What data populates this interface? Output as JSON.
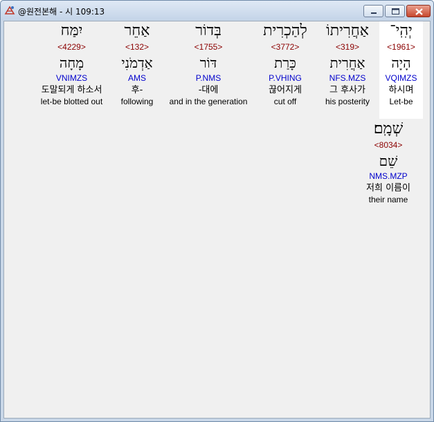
{
  "window": {
    "title": "@원전본해 - 시 109:13"
  },
  "words": [
    {
      "hebrew": "יְהִֽי־",
      "strong": "<1961>",
      "lemma": "הָיָה",
      "morph": "VQIMZS",
      "korean": "하시며",
      "english": "Let-be",
      "selected": true
    },
    {
      "hebrew": "אַחֲרִיתוֹ",
      "strong": "<319>",
      "lemma": "אַחֲרִית",
      "morph": "NFS.MZS",
      "korean": "그 후사가",
      "english": "his posterity"
    },
    {
      "hebrew": "לְהַכְרִית",
      "strong": "<3772>",
      "lemma": "כָּרַת",
      "morph": "P.VHING",
      "korean": "끊어지게",
      "english": "cut off"
    },
    {
      "hebrew": "בְּדוֹר",
      "strong": "<1755>",
      "lemma": "דּוֹר",
      "morph": "P.NMS",
      "korean": "-대에",
      "english": "and in the generation"
    },
    {
      "hebrew": "אַחֵר",
      "strong": "<132>",
      "lemma": "אַדְמֹנִי",
      "morph": "AMS",
      "korean": "후-",
      "english": "following"
    },
    {
      "hebrew": "יִמַּח",
      "strong": "<4229>",
      "lemma": "מָחָה",
      "morph": "VNIMZS",
      "korean": "도말되게 하소서",
      "english": "let-be blotted out"
    },
    {
      "hebrew": "שְׁמָֽם׃",
      "strong": "<8034>",
      "lemma": "שֵׁם",
      "morph": "NMS.MZP",
      "korean": "저희 이름이",
      "english": "their name"
    }
  ]
}
